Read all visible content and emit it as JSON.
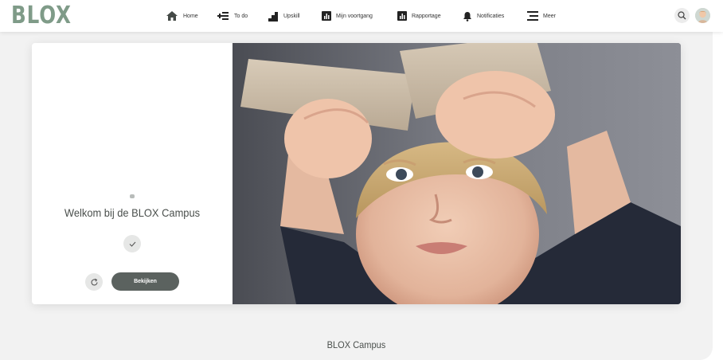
{
  "brand": {
    "logo_text": "BLOX",
    "logo_color": "#7f9b88"
  },
  "nav": {
    "items": [
      {
        "label": "Home",
        "icon": "home-icon"
      },
      {
        "label": "To do",
        "icon": "todo-list-icon"
      },
      {
        "label": "Upskill",
        "icon": "stairs-icon"
      },
      {
        "label": "Mijn voortgang",
        "icon": "progress-chart-icon"
      },
      {
        "label": "Rapportage",
        "icon": "report-chart-icon"
      },
      {
        "label": "Notificaties",
        "icon": "bell-icon"
      },
      {
        "label": "Meer",
        "icon": "menu-icon"
      }
    ]
  },
  "header_actions": {
    "search_icon": "search-icon",
    "avatar": "user-avatar"
  },
  "card": {
    "title": "Welkom bij de BLOX Campus",
    "view_button": "Bekijken",
    "check_icon": "check-icon",
    "refresh_icon": "refresh-icon",
    "image": "toddler-holding-paper-tubes-photo"
  },
  "footer": {
    "title": "BLOX Campus"
  },
  "colors": {
    "button_dark": "#5b625f",
    "page_bg": "#f2f2f2",
    "accent": "#7f9b88"
  }
}
